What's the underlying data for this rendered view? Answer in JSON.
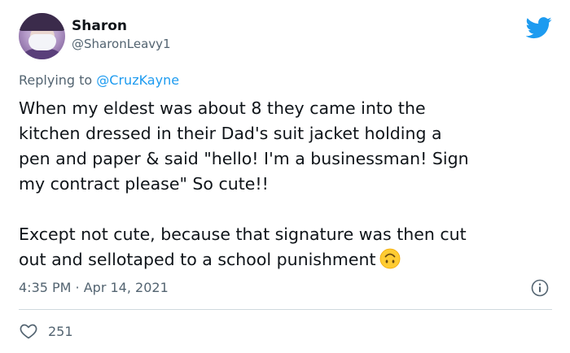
{
  "author": {
    "display_name": "Sharon",
    "handle": "@SharonLeavy1"
  },
  "icons": {
    "name_badge": "crescent-moon-icon",
    "brand": "twitter-bird-icon",
    "info": "info-icon",
    "like": "heart-icon",
    "emoji": "upside-down-face-emoji"
  },
  "reply": {
    "prefix": "Replying to",
    "mention": "@CruzKayne"
  },
  "tweet": {
    "paragraph1": "When my eldest was about 8 they came into the\nkitchen dressed in their Dad's suit jacket holding a\npen and paper & said \"hello! I'm a businessman! Sign\nmy contract please\" So cute!!",
    "paragraph2": "Except not cute, because that signature was then cut\nout and sellotaped to a school punishment"
  },
  "meta": {
    "timestamp": "4:35 PM · Apr 14, 2021"
  },
  "stats": {
    "likes": "251"
  },
  "colors": {
    "accent": "#1d9bf0",
    "secondary_text": "#536471",
    "divider": "#cfd9de"
  }
}
